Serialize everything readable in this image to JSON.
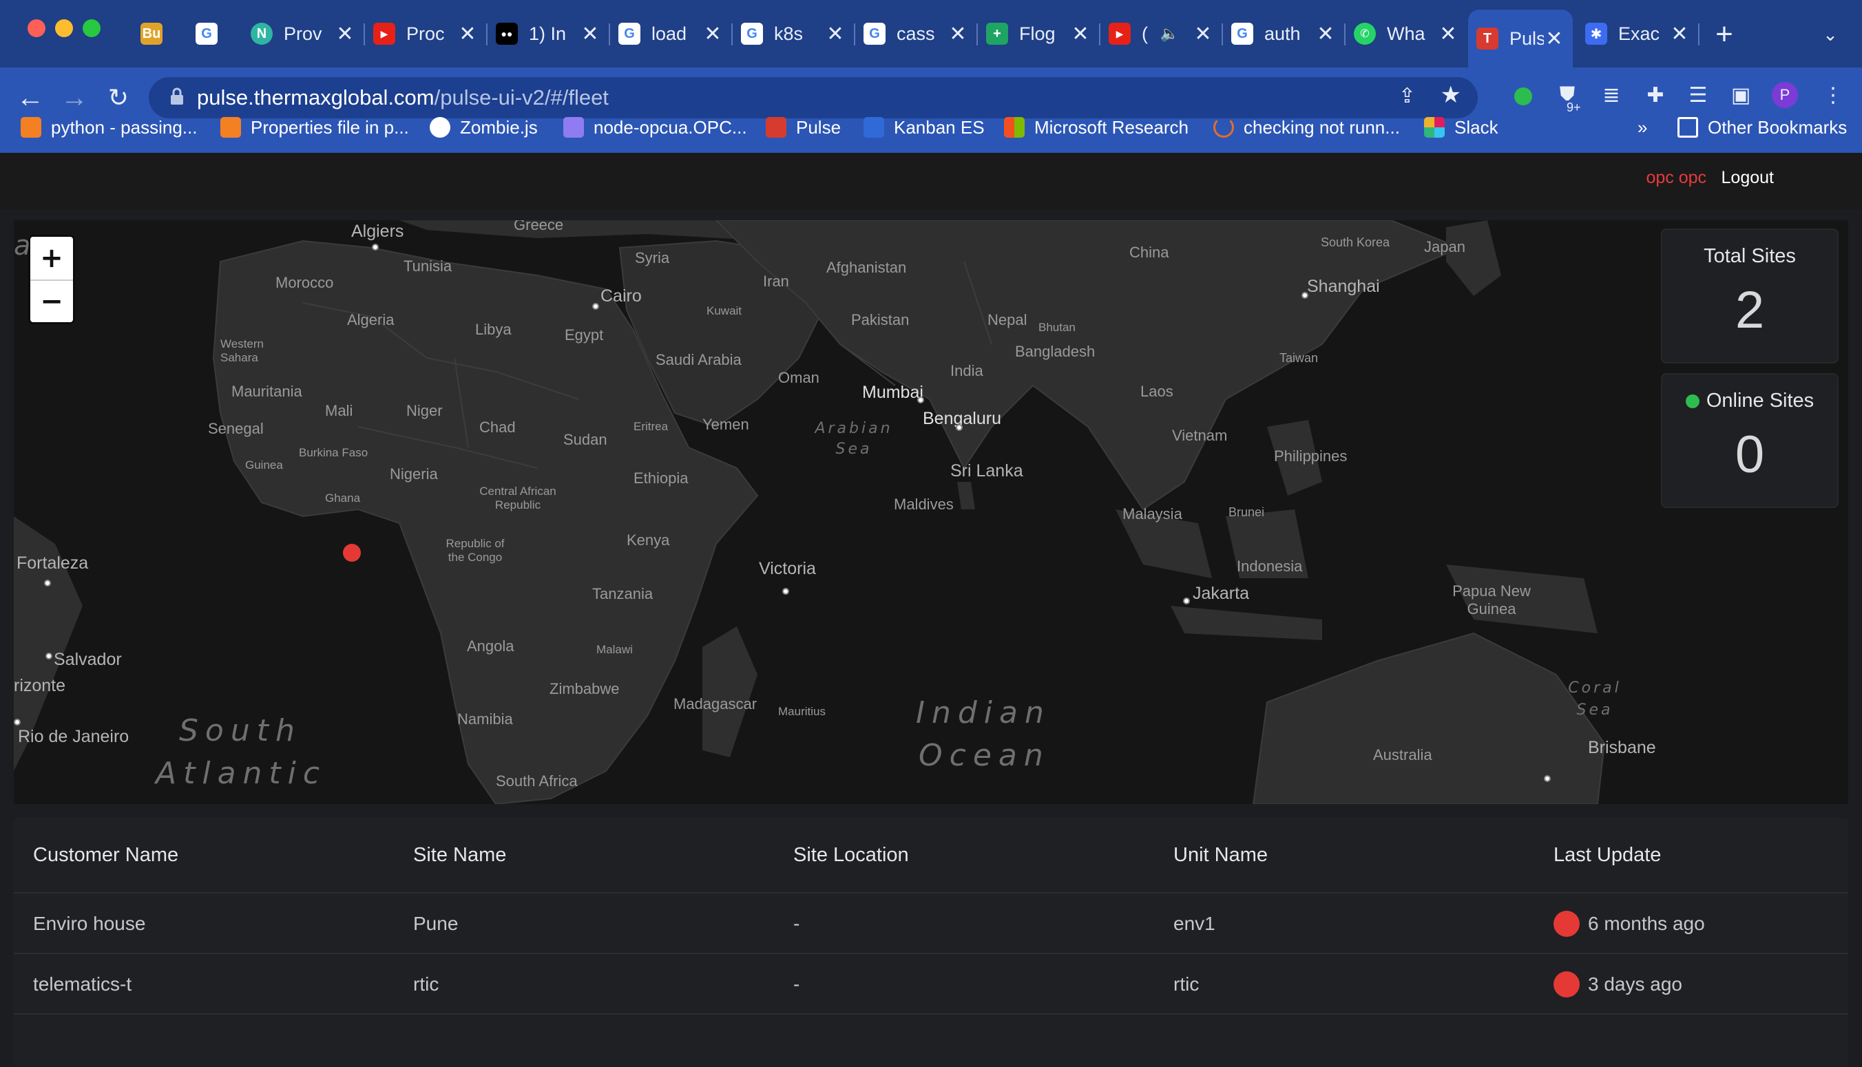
{
  "browser": {
    "tabs": [
      {
        "title": "Bu",
        "icon": "bu-icon",
        "color": "#e0a32a"
      },
      {
        "title": "",
        "icon": "google-icon",
        "color": "#ffffff"
      },
      {
        "title": "Prov",
        "icon": "n-icon",
        "color": "#2fb5a3"
      },
      {
        "title": "Proc",
        "icon": "youtube-icon",
        "color": "#e62117"
      },
      {
        "title": "1) In",
        "icon": "medium-icon",
        "color": "#000000"
      },
      {
        "title": "load",
        "icon": "google-icon",
        "color": "#ffffff"
      },
      {
        "title": "k8s",
        "icon": "google-icon",
        "color": "#ffffff"
      },
      {
        "title": "cass",
        "icon": "google-icon",
        "color": "#ffffff"
      },
      {
        "title": "Flog",
        "icon": "sheets-icon",
        "color": "#1fa463"
      },
      {
        "title": "(",
        "icon": "youtube-icon",
        "color": "#e62117"
      },
      {
        "title": "auth",
        "icon": "google-icon",
        "color": "#ffffff"
      },
      {
        "title": "Wha",
        "icon": "whatsapp-icon",
        "color": "#25d366"
      },
      {
        "title": "Puls",
        "icon": "pulse-icon",
        "color": "#d73a2f"
      },
      {
        "title": "Exac",
        "icon": "exa-icon",
        "color": "#3d6cf0"
      }
    ],
    "url_host": "pulse.thermaxglobal.com",
    "url_path": "/pulse-ui-v2/#/fleet",
    "profile_initial": "P",
    "ext_badge": "9+",
    "bookmarks": [
      {
        "label": "python - passing...",
        "icon": "stackoverflow-icon",
        "color": "#f48024"
      },
      {
        "label": "Properties file in p...",
        "icon": "stackoverflow-icon",
        "color": "#f48024"
      },
      {
        "label": "Zombie.js",
        "icon": "globe-icon",
        "color": "#ffffff"
      },
      {
        "label": "node-opcua.OPC...",
        "icon": "hexagon-icon",
        "color": "#8f7cf2"
      },
      {
        "label": "Pulse",
        "icon": "pulse-icon",
        "color": "#d73a2f"
      },
      {
        "label": "Kanban ES",
        "icon": "trello-icon",
        "color": "#2f6ad8"
      },
      {
        "label": "Microsoft Research",
        "icon": "microsoft-icon",
        "color": "#f25022"
      },
      {
        "label": "checking not runn...",
        "icon": "spinner-icon",
        "color": "#e66b2c"
      },
      {
        "label": "Slack",
        "icon": "slack-icon",
        "color": "#e01e5a"
      }
    ],
    "more_bookmarks": "»",
    "other_bookmarks": "Other Bookmarks"
  },
  "app": {
    "user": "opc opc",
    "logout": "Logout"
  },
  "map": {
    "zoom_in": "+",
    "zoom_out": "−",
    "labels": {
      "algiers": "Algiers",
      "greece": "Greece",
      "tunisia": "Tunisia",
      "morocco": "Morocco",
      "algeria": "Algeria",
      "libya": "Libya",
      "egypt": "Egypt",
      "cairo": "Cairo",
      "syria": "Syria",
      "iran": "Iran",
      "afghanistan": "Afghanistan",
      "kuwait": "Kuwait",
      "pakistan": "Pakistan",
      "saudi": "Saudi Arabia",
      "oman": "Oman",
      "nepal": "Nepal",
      "bhutan": "Bhutan",
      "bangladesh": "Bangladesh",
      "india": "India",
      "mumbai": "Mumbai",
      "china": "China",
      "south_korea": "South Korea",
      "japan": "Japan",
      "shanghai": "Shanghai",
      "taiwan": "Taiwan",
      "western_sahara": "Western Sahara",
      "mauritania": "Mauritania",
      "mali": "Mali",
      "niger": "Niger",
      "chad": "Chad",
      "sudan": "Sudan",
      "eritrea": "Eritrea",
      "yemen": "Yemen",
      "senegal": "Senegal",
      "burkina": "Burkina Faso",
      "guinea": "Guinea",
      "nigeria": "Nigeria",
      "ghana": "Ghana",
      "car": "Central African Republic",
      "ethiopia": "Ethiopia",
      "arabian_sea": "Arabian Sea",
      "bengaluru": "Bengaluru",
      "sri_lanka": "Sri Lanka",
      "maldives": "Maldives",
      "laos": "Laos",
      "vietnam": "Vietnam",
      "philippines": "Philippines",
      "malaysia": "Malaysia",
      "brunei": "Brunei",
      "indonesia": "Indonesia",
      "jakarta": "Jakarta",
      "png": "Papua New Guinea",
      "congo": "Republic of the Congo",
      "kenya": "Kenya",
      "tanzania": "Tanzania",
      "victoria": "Victoria",
      "fortaleza": "Fortaleza",
      "salvador": "Salvador",
      "horizonte": "rizonte",
      "rio": "Rio de Janeiro",
      "angola": "Angola",
      "malawi": "Malawi",
      "zimbabwe": "Zimbabwe",
      "namibia": "Namibia",
      "madagascar": "Madagascar",
      "mauritius": "Mauritius",
      "south_africa": "South Africa",
      "coral_sea": "Coral Sea",
      "australia": "Australia",
      "brisbane": "Brisbane",
      "ocean_top": "an",
      "south_atlantic_1": "South",
      "south_atlantic_2": "Atlantic",
      "indian_1": "Indian",
      "indian_2": "Ocean"
    },
    "marker_color": "#e53935"
  },
  "stats": {
    "total_label": "Total Sites",
    "total_value": "2",
    "online_label": "Online Sites",
    "online_value": "0",
    "online_color": "#2dbd4e"
  },
  "table": {
    "headers": [
      "Customer Name",
      "Site Name",
      "Site Location",
      "Unit Name",
      "Last Update"
    ],
    "rows": [
      {
        "customer": "Enviro house",
        "site": "Pune",
        "location": "-",
        "unit": "env1",
        "last_update": "6 months ago",
        "status_color": "#e53935"
      },
      {
        "customer": "telematics-t",
        "site": "rtic",
        "location": "-",
        "unit": "rtic",
        "last_update": "3 days ago",
        "status_color": "#e53935"
      }
    ]
  }
}
